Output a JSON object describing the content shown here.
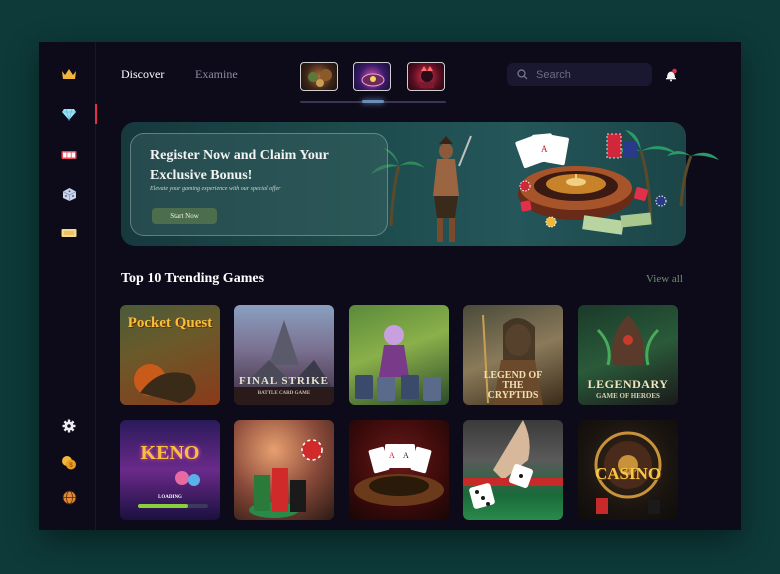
{
  "nav": {
    "discover": "Discover",
    "examine": "Examine"
  },
  "search": {
    "placeholder": "Search"
  },
  "banner": {
    "title": "Register Now and Claim Your Exclusive Bonus!",
    "subtitle": "Elevate your gaming experience with our special offer",
    "button": "Start Now"
  },
  "trending": {
    "title": "Top 10 Trending Games",
    "view_all": "View all",
    "games": [
      {
        "title": "Pocket Quest",
        "icon": "pocket-quest-art"
      },
      {
        "title": "FINAL STRIKE",
        "subtitle": "BATTLE CARD GAME",
        "icon": "final-strike-art"
      },
      {
        "title": "",
        "icon": "fantasy-cards-art"
      },
      {
        "title": "LEGEND OF THE CRYPTIDS",
        "icon": "legend-cryptids-art"
      },
      {
        "title": "LEGENDARY",
        "subtitle": "GAME OF HEROES",
        "icon": "legendary-art"
      },
      {
        "title": "KENO",
        "subtitle": "LOADING",
        "icon": "keno-art"
      },
      {
        "title": "",
        "icon": "casino-chips-art"
      },
      {
        "title": "",
        "icon": "roulette-cards-art"
      },
      {
        "title": "",
        "icon": "dice-throw-art"
      },
      {
        "title": "CASINO",
        "icon": "casino-wheel-art"
      }
    ]
  },
  "sidebar": {
    "icons": [
      "crown-icon",
      "diamond-icon",
      "slots-icon",
      "dice-icon",
      "ticket-icon",
      "gear-icon",
      "coins-icon",
      "globe-icon"
    ]
  },
  "colors": {
    "accent": "#e0314b",
    "background": "#0d0b1a",
    "outer": "#0e3a3a",
    "button": "#4d6e4d",
    "view_all": "#6f8f6a"
  }
}
